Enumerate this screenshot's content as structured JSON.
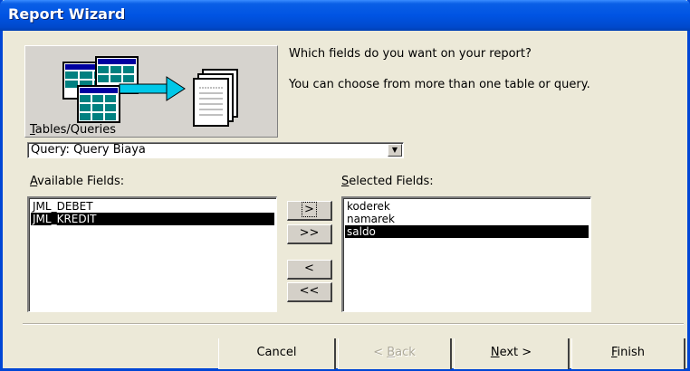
{
  "window": {
    "title": "Report Wizard"
  },
  "prompt": {
    "line1": "Which fields do you want on your report?",
    "line2": "You can choose from more than one table or query."
  },
  "tables_queries": {
    "label_prefix": "",
    "label_accel": "T",
    "label_rest": "ables/Queries",
    "selected": "Query: Query Biaya"
  },
  "available_fields": {
    "label_accel": "A",
    "label_rest": "vailable Fields:",
    "items": [
      "JML_DEBET",
      "JML_KREDIT"
    ],
    "selected_index": 1
  },
  "selected_fields": {
    "label_accel": "S",
    "label_rest": "elected Fields:",
    "items": [
      "koderek",
      "namarek",
      "saldo"
    ],
    "selected_index": 2
  },
  "move_buttons": {
    "add_one": ">",
    "add_all": ">>",
    "remove_one": "<",
    "remove_all": "<<"
  },
  "buttons": {
    "cancel": "Cancel",
    "back_prefix": "< ",
    "back_accel": "B",
    "back_rest": "ack",
    "next_accel": "N",
    "next_rest": "ext >",
    "finish_accel": "F",
    "finish_rest": "inish"
  },
  "colors": {
    "titlebar": "#0054e3",
    "dialog_bg": "#ece9d8",
    "selection": "#000000",
    "illustration_accent": "#00c8e8"
  },
  "icons": [
    "table-stack-icon",
    "arrow-right-icon",
    "report-pages-icon",
    "dropdown-arrow-icon"
  ]
}
